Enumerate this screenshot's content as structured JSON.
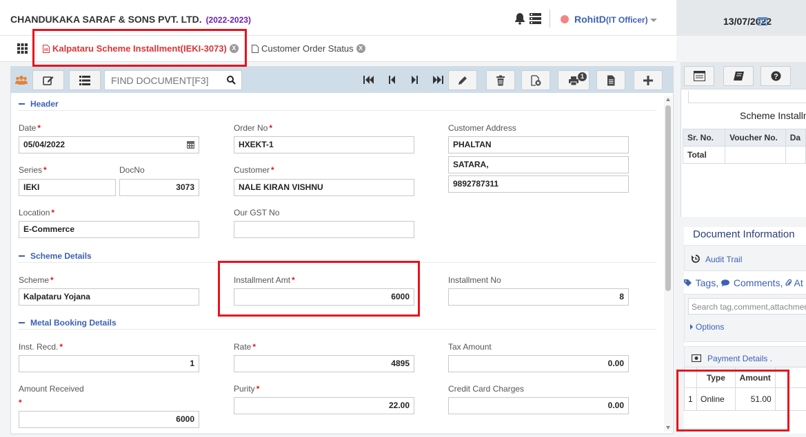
{
  "header": {
    "company": "CHANDUKAKA SARAF & SONS PVT. LTD.",
    "year": "(2022-2023)",
    "user_name": "RohitD",
    "user_role": "(IT Officer)",
    "date": "13/07/2022"
  },
  "tabs": [
    {
      "label": "Kalpataru Scheme Installment(IEKI-3073)",
      "close": "X",
      "active": true
    },
    {
      "label": "Customer Order Status",
      "close": "X",
      "active": false
    }
  ],
  "toolbar": {
    "find_placeholder": "FIND DOCUMENT[F3]",
    "print_badge": "1"
  },
  "sections": {
    "header": "Header",
    "scheme": "Scheme Details",
    "metal": "Metal Booking Details"
  },
  "form": {
    "date": {
      "label": "Date",
      "value": "05/04/2022"
    },
    "order_no": {
      "label": "Order No",
      "value": "HXEKT-1"
    },
    "customer_address": {
      "label": "Customer Address",
      "line1": "PHALTAN",
      "line2": "SATARA,",
      "line3": "9892787311"
    },
    "series": {
      "label": "Series",
      "value": "IEKI"
    },
    "docno": {
      "label": "DocNo",
      "value": "3073"
    },
    "customer": {
      "label": "Customer",
      "value": "NALE KIRAN VISHNU"
    },
    "location": {
      "label": "Location",
      "value": "E-Commerce"
    },
    "gst": {
      "label": "Our GST No",
      "value": ""
    },
    "scheme": {
      "label": "Scheme",
      "value": "Kalpataru Yojana"
    },
    "installment_amt": {
      "label": "Installment Amt",
      "value": "6000"
    },
    "installment_no": {
      "label": "Installment No",
      "value": "8"
    },
    "inst_recd": {
      "label": "Inst. Recd.",
      "value": "1"
    },
    "rate": {
      "label": "Rate",
      "value": "4895"
    },
    "tax_amount": {
      "label": "Tax Amount",
      "value": "0.00"
    },
    "amount_received": {
      "label": "Amount Received",
      "value": "6000"
    },
    "purity": {
      "label": "Purity",
      "value": "22.00"
    },
    "credit_card_charges": {
      "label": "Credit Card Charges",
      "value": "0.00"
    }
  },
  "side": {
    "scheme_title": "Scheme Installment",
    "table_headers": [
      "Sr. No.",
      "Voucher No.",
      "Da"
    ],
    "total_label": "Total",
    "doc_info_title": "Document Information",
    "audit_trail": "Audit Trail",
    "tags": "Tags,",
    "comments": "Comments,",
    "attachments": "At",
    "search_placeholder": "Search tag,comment,attachment",
    "options": "Options",
    "payment_details": "Payment Details .",
    "payment_headers": [
      "",
      "Type",
      "Amount"
    ],
    "payment_rows": [
      {
        "sr": "1",
        "type": "Online",
        "amount": "51.00"
      }
    ]
  },
  "colors": {
    "accent": "#3c61b5",
    "highlight": "#e8111b",
    "active_tab": "#d33"
  }
}
